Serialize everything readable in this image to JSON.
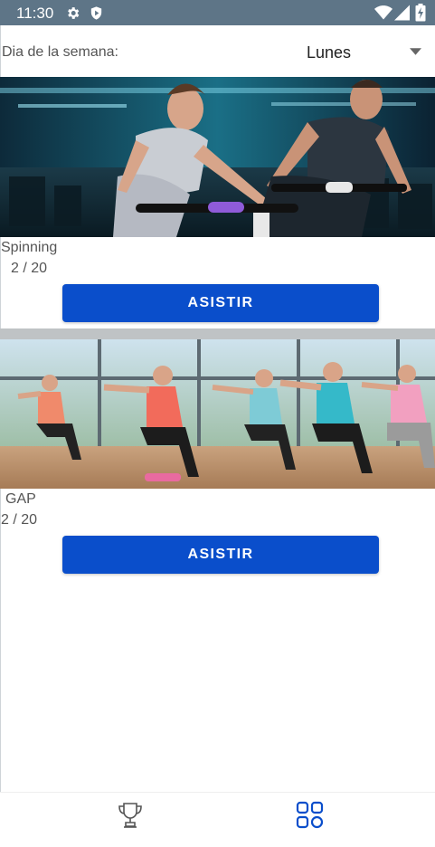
{
  "status_bar": {
    "time": "11:30",
    "background": "#5e7587",
    "icons": [
      "settings-icon",
      "shield-play-icon",
      "wifi-icon",
      "signal-icon",
      "battery-charging-icon"
    ]
  },
  "day_selector": {
    "label": "Dia de la semana:",
    "selected": "Lunes"
  },
  "classes": [
    {
      "name": "Spinning",
      "count": "2 / 20",
      "button_label": "ASISTIR",
      "image": "spinning-class-photo"
    },
    {
      "name": "GAP",
      "count": "2 / 20",
      "button_label": "ASISTIR",
      "image": "gap-class-photo"
    }
  ],
  "bottom_nav": {
    "items": [
      {
        "icon": "trophy-icon",
        "active": false
      },
      {
        "icon": "grid-icon",
        "active": true
      }
    ]
  },
  "colors": {
    "accent": "#0a4ecb",
    "text_secondary": "#555555"
  }
}
